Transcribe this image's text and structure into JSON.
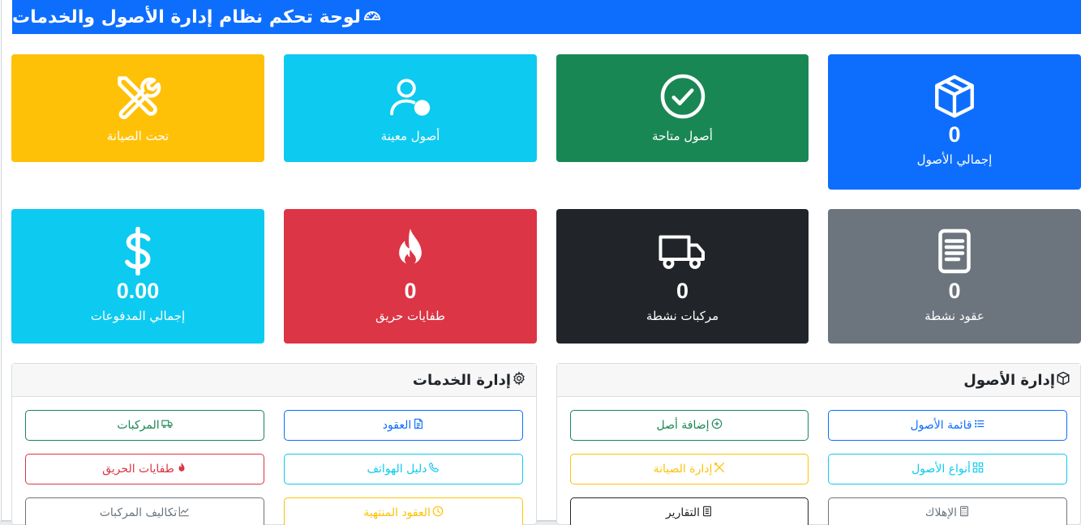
{
  "header": {
    "title": "لوحة تحكم نظام إدارة الأصول والخدمات",
    "icon": "speedometer-icon"
  },
  "colors": {
    "primary": "#0d6efd",
    "success": "#198754",
    "info": "#0dcaf0",
    "warning": "#ffc107",
    "danger": "#dc3545",
    "dark": "#212529",
    "secondary": "#6c757d"
  },
  "cards": {
    "total_assets": {
      "value": "0",
      "label": "إجمالي الأصول",
      "icon": "box-icon"
    },
    "available_assets": {
      "label": "أصول متاحة",
      "icon": "check-circle-icon"
    },
    "assigned_assets": {
      "label": "أصول معينة",
      "icon": "person-icon"
    },
    "under_maintenance": {
      "label": "تحت الصيانة",
      "icon": "tools-icon"
    },
    "active_contracts": {
      "value": "0",
      "label": "عقود نشطة",
      "icon": "document-icon"
    },
    "active_vehicles": {
      "value": "0",
      "label": "مركبات نشطة",
      "icon": "truck-icon"
    },
    "fire_extinguishers": {
      "value": "0",
      "label": "طفايات حريق",
      "icon": "fire-icon"
    },
    "total_payments": {
      "value": "0.00",
      "label": "إجمالي المدفوعات",
      "icon": "dollar-icon"
    }
  },
  "asset_management": {
    "title": "إدارة الأصول",
    "buttons": {
      "asset_list": "قائمة الأصول",
      "add_asset": "إضافة أصل",
      "asset_types": "أنواع الأصول",
      "maintenance": "إدارة الصيانة",
      "depreciation": "الإهلاك",
      "reports": "التقارير"
    }
  },
  "services_management": {
    "title": "إدارة الخدمات",
    "buttons": {
      "contracts": "العقود",
      "vehicles": "المركبات",
      "phone_directory": "دليل الهواتف",
      "fire_extinguishers": "طفايات الحريق",
      "expired_contracts": "العقود المنتهية",
      "vehicle_costs": "تكاليف المركبات"
    }
  }
}
